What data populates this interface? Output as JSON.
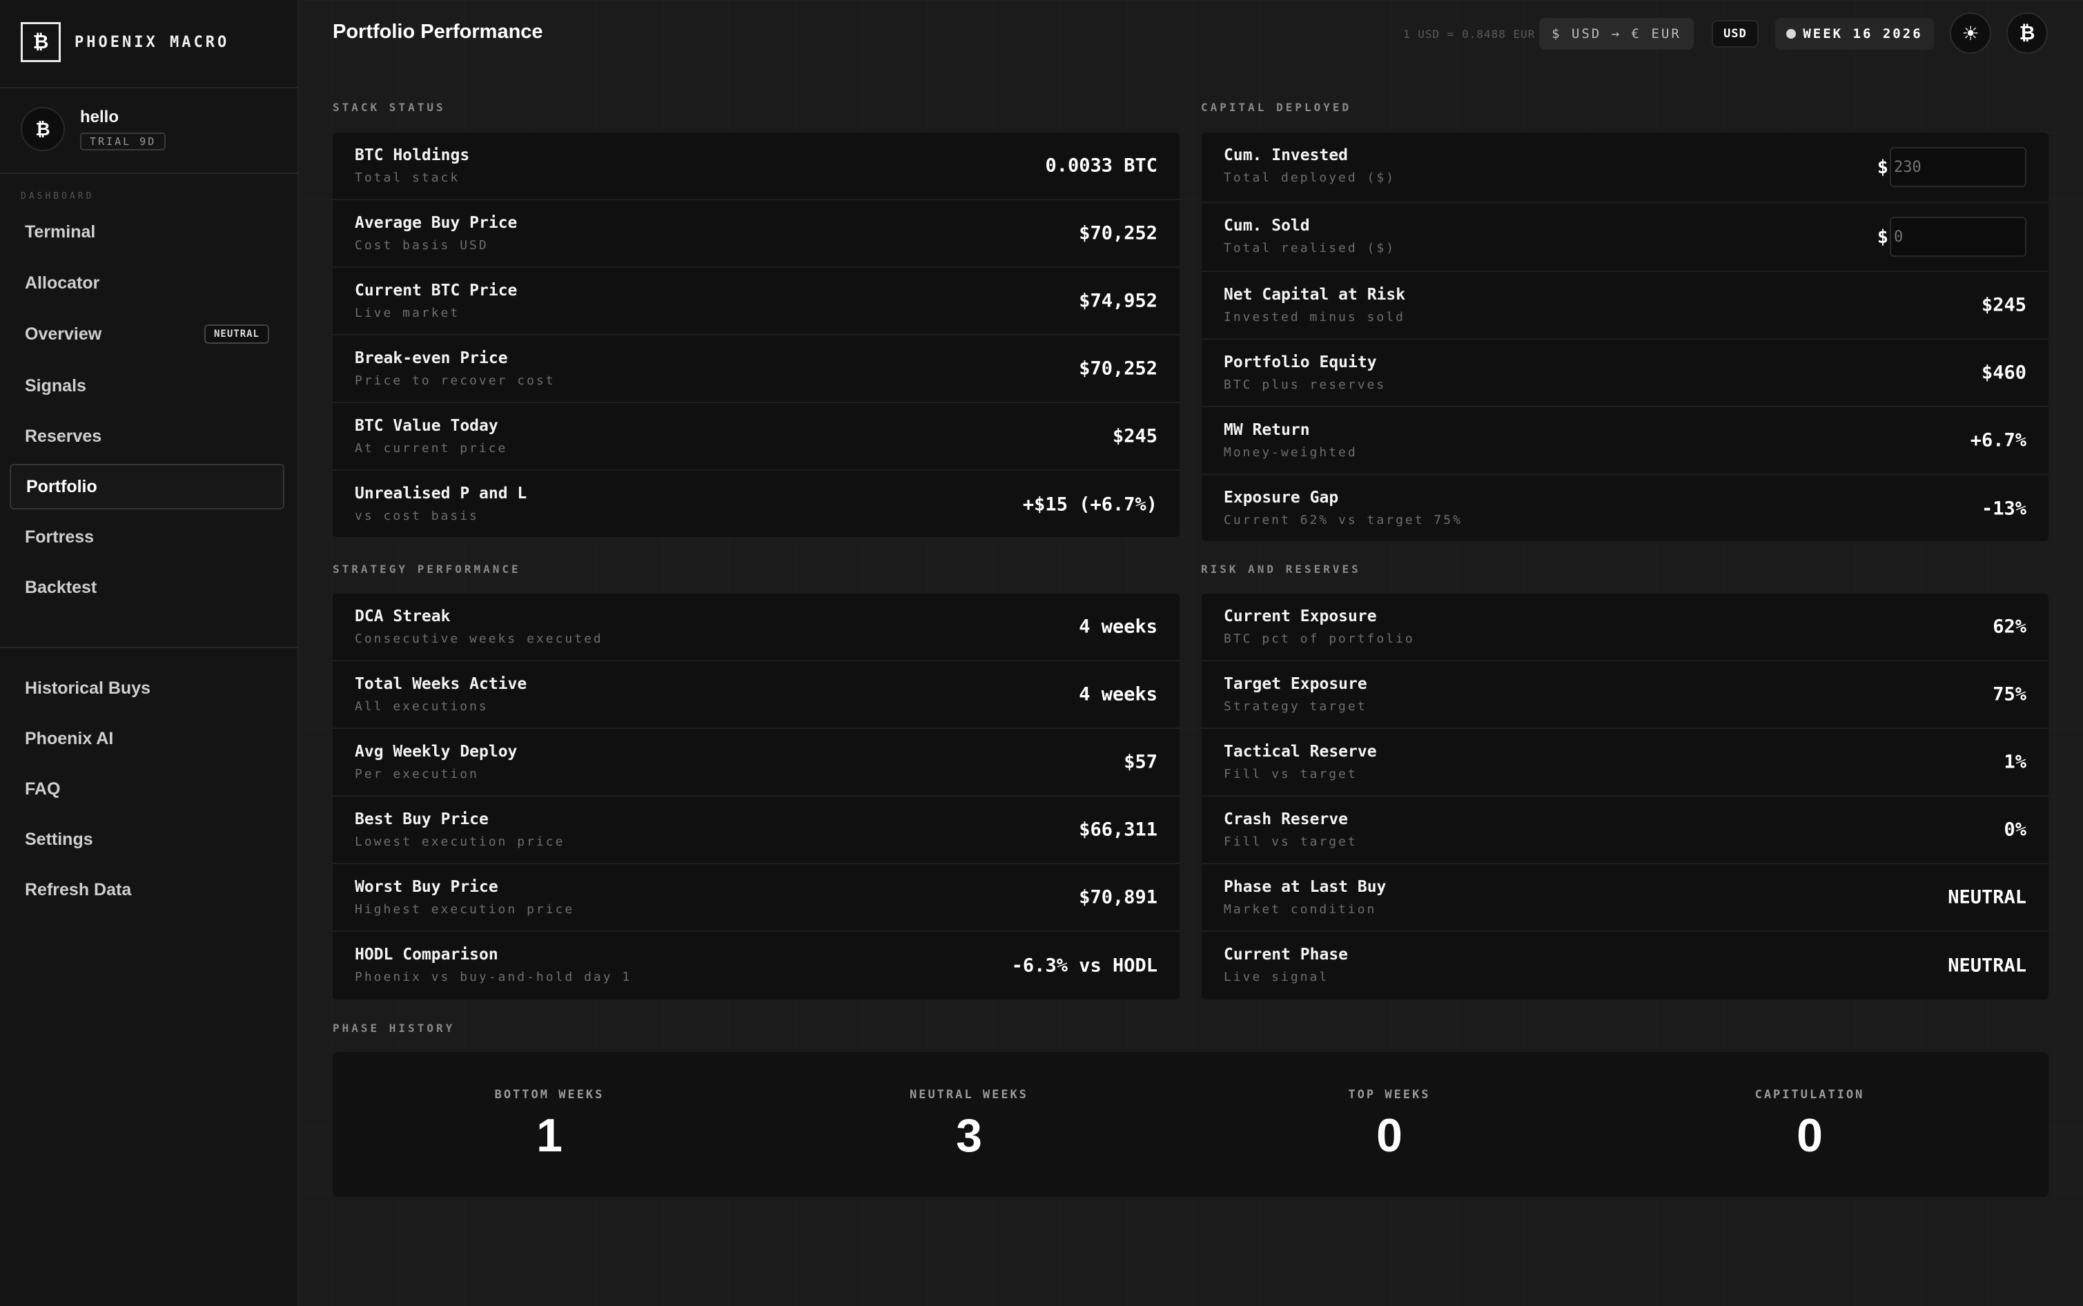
{
  "brand": {
    "logo": "₿",
    "name": "PHOENIX MACRO"
  },
  "user": {
    "avatar": "₿",
    "name": "hello",
    "badge": "TRIAL 9D"
  },
  "sidebar": {
    "section_label": "DASHBOARD",
    "items": [
      {
        "label": "Terminal"
      },
      {
        "label": "Allocator"
      },
      {
        "label": "Overview",
        "badge": "NEUTRAL"
      },
      {
        "label": "Signals"
      },
      {
        "label": "Reserves"
      },
      {
        "label": "Portfolio",
        "active": true
      },
      {
        "label": "Fortress"
      },
      {
        "label": "Backtest"
      }
    ],
    "secondary_items": [
      {
        "label": "Historical Buys"
      },
      {
        "label": "Phoenix AI"
      },
      {
        "label": "FAQ"
      },
      {
        "label": "Settings"
      },
      {
        "label": "Refresh Data"
      }
    ]
  },
  "header": {
    "title": "Portfolio Performance",
    "fx_rate": "1 USD = 0.8488 EUR",
    "currency_toggle": "$ USD → € EUR",
    "currency": "USD",
    "week": "WEEK 16 2026",
    "theme_icon": "☀",
    "profile_icon": "₿"
  },
  "stack_status": {
    "title": "STACK STATUS",
    "rows": [
      {
        "label": "BTC Holdings",
        "sub": "Total stack",
        "value": "0.0033 BTC"
      },
      {
        "label": "Average Buy Price",
        "sub": "Cost basis USD",
        "value": "$70,252"
      },
      {
        "label": "Current BTC Price",
        "sub": "Live market",
        "value": "$74,952"
      },
      {
        "label": "Break-even Price",
        "sub": "Price to recover cost",
        "value": "$70,252"
      },
      {
        "label": "BTC Value Today",
        "sub": "At current price",
        "value": "$245"
      },
      {
        "label": "Unrealised P and L",
        "sub": "vs cost basis",
        "value": "+$15 (+6.7%)"
      }
    ]
  },
  "capital_deployed": {
    "title": "CAPITAL DEPLOYED",
    "cum_invested": {
      "label": "Cum. Invested",
      "sub": "Total deployed ($)",
      "prefix": "$",
      "placeholder": "230"
    },
    "cum_sold": {
      "label": "Cum. Sold",
      "sub": "Total realised ($)",
      "prefix": "$",
      "placeholder": "0"
    },
    "rows": [
      {
        "label": "Net Capital at Risk",
        "sub": "Invested minus sold",
        "value": "$245"
      },
      {
        "label": "Portfolio Equity",
        "sub": "BTC plus reserves",
        "value": "$460"
      },
      {
        "label": "MW Return",
        "sub": "Money-weighted",
        "value": "+6.7%"
      },
      {
        "label": "Exposure Gap",
        "sub": "Current 62% vs target 75%",
        "value": "-13%"
      }
    ]
  },
  "strategy_performance": {
    "title": "STRATEGY PERFORMANCE",
    "rows": [
      {
        "label": "DCA Streak",
        "sub": "Consecutive weeks executed",
        "value": "4 weeks"
      },
      {
        "label": "Total Weeks Active",
        "sub": "All executions",
        "value": "4 weeks"
      },
      {
        "label": "Avg Weekly Deploy",
        "sub": "Per execution",
        "value": "$57"
      },
      {
        "label": "Best Buy Price",
        "sub": "Lowest execution price",
        "value": "$66,311"
      },
      {
        "label": "Worst Buy Price",
        "sub": "Highest execution price",
        "value": "$70,891"
      },
      {
        "label": "HODL Comparison",
        "sub": "Phoenix vs buy-and-hold day 1",
        "value": "-6.3% vs HODL"
      }
    ]
  },
  "risk_reserves": {
    "title": "RISK AND RESERVES",
    "rows": [
      {
        "label": "Current Exposure",
        "sub": "BTC pct of portfolio",
        "value": "62%"
      },
      {
        "label": "Target Exposure",
        "sub": "Strategy target",
        "value": "75%"
      },
      {
        "label": "Tactical Reserve",
        "sub": "Fill vs target",
        "value": "1%"
      },
      {
        "label": "Crash Reserve",
        "sub": "Fill vs target",
        "value": "0%"
      },
      {
        "label": "Phase at Last Buy",
        "sub": "Market condition",
        "value": "NEUTRAL"
      },
      {
        "label": "Current Phase",
        "sub": "Live signal",
        "value": "NEUTRAL"
      }
    ]
  },
  "phase_history": {
    "title": "PHASE HISTORY",
    "items": [
      {
        "label": "BOTTOM WEEKS",
        "value": "1"
      },
      {
        "label": "NEUTRAL WEEKS",
        "value": "3"
      },
      {
        "label": "TOP WEEKS",
        "value": "0"
      },
      {
        "label": "CAPITULATION",
        "value": "0"
      }
    ]
  }
}
